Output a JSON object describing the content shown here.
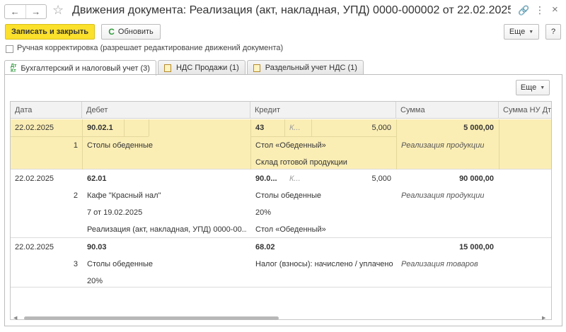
{
  "window": {
    "title": "Движения документа: Реализация (акт, накладная, УПД) 0000-000002 от 22.02.2025 ...",
    "back": "←",
    "forward": "→",
    "star": "☆",
    "link": "🔗",
    "menu": "⋮",
    "close": "×"
  },
  "toolbar": {
    "save_close": "Записать и закрыть",
    "refresh": "Обновить",
    "more": "Еще",
    "help": "?"
  },
  "manual_edit": {
    "label": "Ручная корректировка (разрешает редактирование движений документа)",
    "checked": false
  },
  "tabs": [
    {
      "label": "Бухгалтерский и налоговый учет (3)",
      "active": true
    },
    {
      "label": "НДС Продажи (1)",
      "active": false
    },
    {
      "label": "Раздельный учет НДС (1)",
      "active": false
    }
  ],
  "table": {
    "more": "Еще",
    "columns": [
      "Дата",
      "Дебет",
      "Кредит",
      "Сумма",
      "Сумма НУ Дт"
    ],
    "rows": [
      {
        "date": "22.02.2025",
        "num": "1",
        "debit_account": "90.02.1",
        "debit_lines": [
          "Столы обеденные"
        ],
        "credit_account": "43",
        "credit_k": "К...",
        "credit_qty": "5,000",
        "credit_lines": [
          "Стол «Обеденный»",
          "Склад готовой продукции"
        ],
        "sum": "5 000,00",
        "sum_note": "Реализация продукции",
        "selected": true
      },
      {
        "date": "22.02.2025",
        "num": "2",
        "debit_account": "62.01",
        "debit_lines": [
          "Кафе \"Красный нал\"",
          "7 от 19.02.2025",
          "Реализация (акт, накладная, УПД) 0000-00..."
        ],
        "credit_account": "90.0...",
        "credit_k": "К...",
        "credit_qty": "5,000",
        "credit_lines": [
          "Столы обеденные",
          "20%",
          "Стол «Обеденный»"
        ],
        "sum": "90 000,00",
        "sum_note": "Реализация продукции",
        "selected": false
      },
      {
        "date": "22.02.2025",
        "num": "3",
        "debit_account": "90.03",
        "debit_lines": [
          "Столы обеденные",
          "20%"
        ],
        "credit_account": "68.02",
        "credit_k": "",
        "credit_qty": "",
        "credit_lines": [
          "Налог (взносы): начислено / уплачено"
        ],
        "sum": "15 000,00",
        "sum_note": "Реализация товаров",
        "selected": false
      }
    ]
  },
  "colors": {
    "primary": "#fbe02c",
    "selected_row": "#fbeeb5",
    "refresh_icon": "#2f9a3c"
  }
}
